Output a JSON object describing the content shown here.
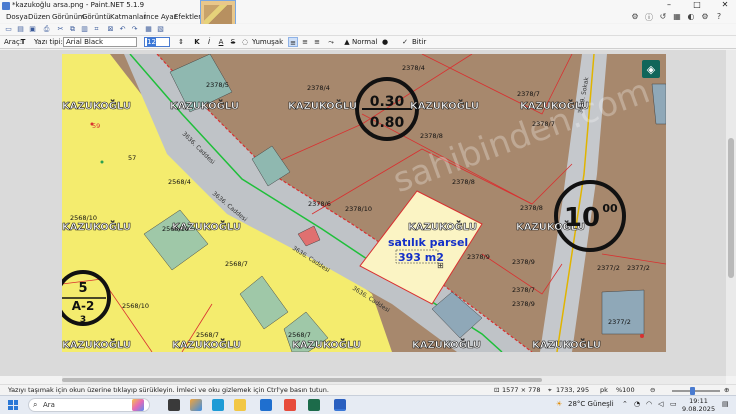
{
  "window": {
    "title": "*kazukoğlu arsa.png - Paint.NET 5.1.9",
    "controls": [
      "–",
      "□",
      "✕"
    ]
  },
  "menu": {
    "items": [
      "Dosya",
      "Düzen",
      "Görünüm",
      "Görüntü",
      "Katmanlar",
      "İnce Ayar",
      "Efektler"
    ]
  },
  "text_toolbar": {
    "tool_label": "Araç:",
    "font_label": "Yazı tipi:",
    "font_value": "Arial Black",
    "size_value": "12",
    "bold": "K",
    "italic": "İ",
    "underline": "A",
    "strike": "S",
    "antialias_label": "Yumuşak",
    "blend_label": "Normal",
    "finish_label": "Bitir"
  },
  "map": {
    "watermark": "sahibinden.com",
    "parcel_text_line1": "satılık parsel",
    "parcel_text_line2": "393 m2",
    "owner_label": "KAZUKOĞLU",
    "zoning_top": "0.30",
    "zoning_bottom": "0.80",
    "big_label": "10",
    "big_label_sup": "00",
    "pafta_number": "5",
    "pafta_letter": "A-2",
    "pafta_sub": "3",
    "street_name": "3639. Sokak",
    "street_name2": "3636. Caddesi",
    "parcel_numbers": [
      "2378/4",
      "2378/4",
      "2378/7",
      "2378/8",
      "2378/8",
      "2378/7",
      "2378/6",
      "2378/10",
      "2378/9",
      "2378/9",
      "2378/8",
      "2378/9",
      "2377/2",
      "2377/2",
      "2377/2",
      "2568/4",
      "2568/10",
      "2568/10",
      "2568/7",
      "2568/7",
      "2568/7",
      "2568/10",
      "2378/5",
      "2378/7"
    ],
    "point_numbers": [
      "59",
      "57"
    ]
  },
  "status": {
    "hint": "Yazıyı taşımak için okun üzerine tıklayıp sürükleyin. İmleci ve oku gizlemek için Ctrl'ye basın tutun.",
    "image_size": "1577 × 778",
    "cursor_pos": "1733, 295",
    "unit": "pk",
    "zoom": "%100"
  },
  "taskbar": {
    "search_placeholder": "Ara",
    "weather": "28°C  Güneşli",
    "time": "19:11",
    "date": "9.08.2025"
  },
  "colors": {
    "accent": "#3b78d8",
    "parcel_brown": "#a7886d",
    "zone_yellow": "#f4ec6e",
    "highlight_parcel": "#fbf4c4",
    "road_gray": "#bfc3c7",
    "boundary_red": "#d93030"
  }
}
